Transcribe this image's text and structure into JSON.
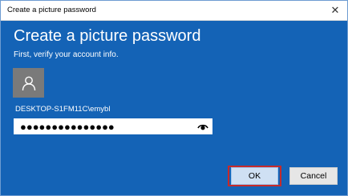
{
  "window": {
    "title": "Create a picture password",
    "close_glyph": "✕"
  },
  "dialog": {
    "heading": "Create a picture password",
    "subtitle": "First, verify your account info.",
    "avatar_icon": "user-avatar-icon",
    "account_name": "DESKTOP-S1FM11C\\emybl",
    "password_masked": "●●●●●●●●●●●●●●●",
    "reveal_icon": "eye-icon"
  },
  "buttons": {
    "ok_label": "OK",
    "cancel_label": "Cancel"
  },
  "colors": {
    "background": "#1463b6",
    "highlight": "#c62a2a",
    "avatar_bg": "#7a7a7a"
  }
}
